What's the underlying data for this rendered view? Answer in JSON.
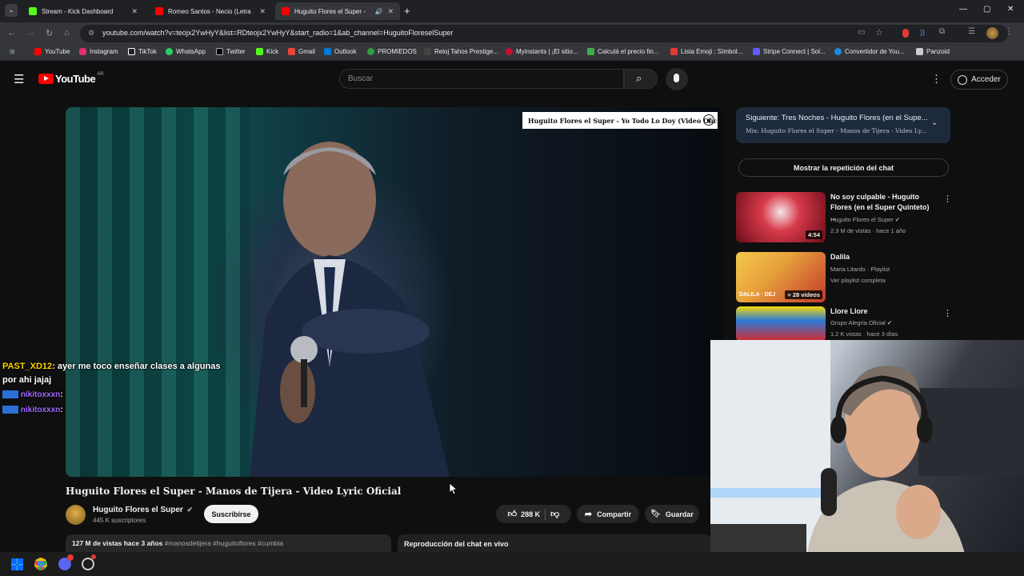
{
  "browser": {
    "tabs": [
      {
        "title": "Stream - Kick Dashboard",
        "favicon_color": "#53fc18",
        "active": false
      },
      {
        "title": "Romeo Santos - Necio (Letra",
        "favicon_color": "#ff0000",
        "active": false
      },
      {
        "title": "Huguito Flores el Super -",
        "favicon_color": "#ff0000",
        "active": true
      }
    ],
    "url": "youtube.com/watch?v=teojx2YwHyY&list=RDteojx2YwHyY&start_radio=1&ab_channel=HuguitoFloreselSuper",
    "bookmarks": [
      {
        "label": "YouTube",
        "color": "#ff0000"
      },
      {
        "label": "Instagram",
        "color": "#e1306c"
      },
      {
        "label": "TikTok",
        "color": "#ffffff"
      },
      {
        "label": "WhatsApp",
        "color": "#25d366"
      },
      {
        "label": "Twitter",
        "color": "#ffffff"
      },
      {
        "label": "Kick",
        "color": "#53fc18"
      },
      {
        "label": "Gmail",
        "color": "#ea4335"
      },
      {
        "label": "Outlook",
        "color": "#0078d4"
      },
      {
        "label": "PROMIEDOS",
        "color": "#2e9e3e"
      },
      {
        "label": "Reloj Tahos Prestige...",
        "color": "#444444"
      },
      {
        "label": "Myinstants | ¡El sitio...",
        "color": "#c8102e"
      },
      {
        "label": "Calculá el precio fin...",
        "color": "#3fae49"
      },
      {
        "label": "Lista Emoji : Símbol...",
        "color": "#e53935"
      },
      {
        "label": "Stripe Connect | Sol...",
        "color": "#635bff"
      },
      {
        "label": "Convertidor de You...",
        "color": "#1e88e5"
      },
      {
        "label": "Panzoid",
        "color": "#cccccc"
      }
    ]
  },
  "youtube": {
    "logo": "YouTube",
    "region": "AR",
    "search_placeholder": "Buscar",
    "signin_label": "Acceder",
    "video_overlay_title": "Huguito Flores el Super - Yo Todo Lo Doy (Video Oficial)",
    "title": "Huguito Flores el Super - Manos de Tijera - Video Lyric Oficial",
    "channel": "Huguito Flores el Super",
    "subscribers": "445 K suscriptores",
    "subscribe_label": "Suscribirse",
    "likes": "288 K",
    "share_label": "Compartir",
    "save_label": "Guardar",
    "views_date": "127 M de vistas  hace 3 años",
    "hashtags": "#manosdetijera #huguitoflores #cumbia",
    "chat_replay_label": "Reproducción del chat en vivo",
    "up_next": {
      "label": "Siguiente:",
      "title": "Tres Noches - Huguito Flores (en el Supe...",
      "mix": "Mix: Huguito Flores el Super - Manos de Tijera - Video Ly..."
    },
    "show_chat_label": "Mostrar la repetición del chat",
    "recommendations": [
      {
        "title": "No soy culpable - Huguito Flores (en el Super Quinteto) ...",
        "channel": "Huguito Flores el Super",
        "meta": "2.3 M de vistas · hace 1 año",
        "duration": "4:54"
      },
      {
        "title": "Dalila",
        "channel": "Maria Litardo · Playlist",
        "meta": "Ver playlist completa",
        "duration": "28 videos",
        "thumb_text": "DALILA · DEJ"
      },
      {
        "title": "Llore Llore",
        "channel": "Grupo Alegria Oficial",
        "meta": "1.2 K vistas · hace 3 días",
        "duration": ""
      }
    ]
  },
  "stream_chat": [
    {
      "user": "PAST_XD12",
      "message": ": ayer me toco enseñar clases a algunas",
      "message2": "por ahi jajaj"
    },
    {
      "user": "nikitoxxxn",
      "message": ":"
    },
    {
      "user": "nikitoxxxn",
      "message": ":"
    }
  ],
  "colors": {
    "yt_bg": "#0f0f0f",
    "brand_red": "#ff0000",
    "chat_user_yellow": "#ffd400",
    "chat_user_purple": "#a46bff"
  }
}
